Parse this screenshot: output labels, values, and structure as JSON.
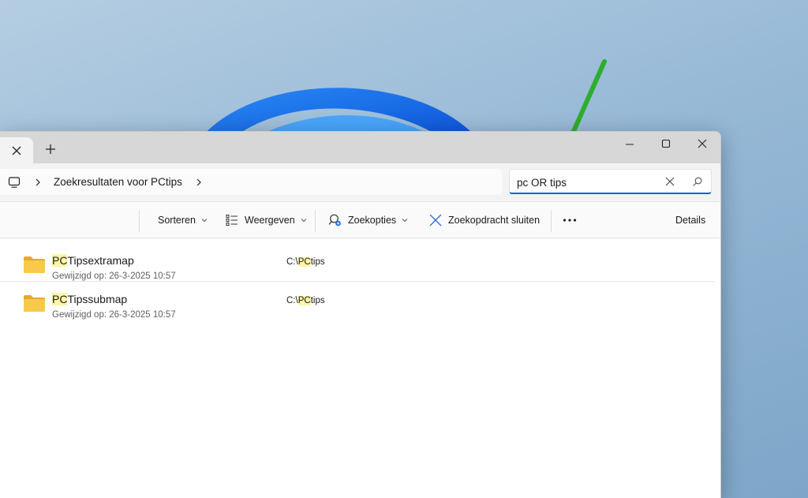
{
  "window": {
    "new_tab_icon": "plus-icon",
    "controls": [
      "minimize-icon",
      "maximize-icon",
      "close-icon"
    ]
  },
  "address": {
    "root_icon": "monitor-icon",
    "location": "Zoekresultaten voor PCtips"
  },
  "search": {
    "value": "pc OR tips"
  },
  "toolbar": {
    "sort_label": "Sorteren",
    "view_label": "Weergeven",
    "search_options_label": "Zoekopties",
    "close_search_label": "Zoekopdracht sluiten",
    "more_icon": "more-icon",
    "details_label": "Details"
  },
  "results": [
    {
      "name_highlight": "PC",
      "name_rest": "Tipsextramap",
      "modified_label": "Gewijzigd op:",
      "modified": "26-3-2025 10:57",
      "path_prefix": "C:\\",
      "path_highlight": "PC",
      "path_rest": "tips"
    },
    {
      "name_highlight": "PC",
      "name_rest": "Tipssubmap",
      "modified_label": "Gewijzigd op:",
      "modified": "26-3-2025 10:57",
      "path_prefix": "C:\\",
      "path_highlight": "PC",
      "path_rest": "tips"
    }
  ],
  "colors": {
    "accent": "#0067c0",
    "highlight": "#fdf5a7",
    "annotation_arrow": "#2ead2e",
    "folder": "#f8c94a"
  }
}
